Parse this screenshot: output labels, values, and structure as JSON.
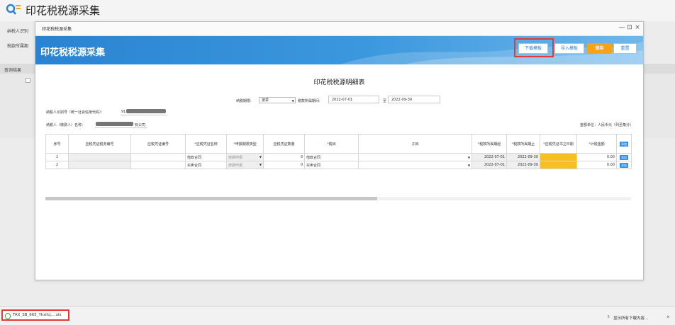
{
  "page": {
    "title": "印花税税源采集",
    "labels": {
      "taxpayer_id": "纳税人识别",
      "period": "税款所属期",
      "query_result": "查询结果"
    }
  },
  "dialog": {
    "titlebar": "印花税税源采集",
    "banner_title": "印花税税源采集",
    "controls": {
      "minimize": "—",
      "restore": "⊡",
      "close": "×"
    },
    "buttons": {
      "download_template": "下载模板",
      "import_template": "导入模板",
      "save": "保存",
      "reset": "重置"
    },
    "form_title": "印花税税源明细表",
    "filter": {
      "period_type_label": "纳税期限:",
      "period_type_value": "按季",
      "period_label": "税款所属期间:",
      "period_start": "2022-07-01",
      "period_sep": "至",
      "period_end": "2022-09-30"
    },
    "taxpayer": {
      "id_label": "纳税人识别号（统一社会信用代码）：",
      "id_prefix": "91",
      "name_label": "纳税人（缴费人）名称：",
      "name_suffix": "有公司"
    },
    "unit_text": "金额单位：人民币元（列至角分）",
    "table": {
      "columns": [
        {
          "label": "序号",
          "required": false
        },
        {
          "label": "应税凭证税务编号",
          "required": false
        },
        {
          "label": "应税凭证编号",
          "required": false
        },
        {
          "label": "应税凭证名称",
          "required": true
        },
        {
          "label": "申报期限类型",
          "required": true
        },
        {
          "label": "应税凭证数量",
          "required": false
        },
        {
          "label": "税目",
          "required": true
        },
        {
          "label": "子目",
          "required": false
        },
        {
          "label": "税款所属期起",
          "required": true
        },
        {
          "label": "税款所属期止",
          "required": true
        },
        {
          "label": "应税凭证书立日期",
          "required": true
        },
        {
          "label": "计税金额",
          "required": true
        },
        {
          "label": "添加",
          "required": false
        }
      ],
      "rows": [
        {
          "no": "1",
          "tax_no": "",
          "voucher_no": "",
          "voucher_name": "借款合同",
          "period_type": "按期申报",
          "qty": "0",
          "item": "借款合同",
          "sub_item": "",
          "start": "2022-07-01",
          "end": "2022-09-30",
          "sign_date": "",
          "amount": "0.00",
          "action": "添加"
        },
        {
          "no": "2",
          "tax_no": "",
          "voucher_no": "",
          "voucher_name": "买卖合同",
          "period_type": "按期申报",
          "qty": "0",
          "item": "买卖合同",
          "sub_item": "",
          "start": "2022-07-01",
          "end": "2022-09-30",
          "sign_date": "",
          "amount": "0.00",
          "action": "添加"
        }
      ]
    }
  },
  "download_bar": {
    "file_name": "TAX_SB_665_Yhsllcj....xls",
    "show_all": "显示所有下载内容...",
    "close": "×"
  },
  "colors": {
    "banner": "#2a83d1",
    "save": "#f6a21b",
    "highlight": "#e53935",
    "date_cell": "#f6c022"
  },
  "icons": {
    "logo": "search-list-icon",
    "file": "excel-file-icon",
    "download": "download-icon"
  }
}
